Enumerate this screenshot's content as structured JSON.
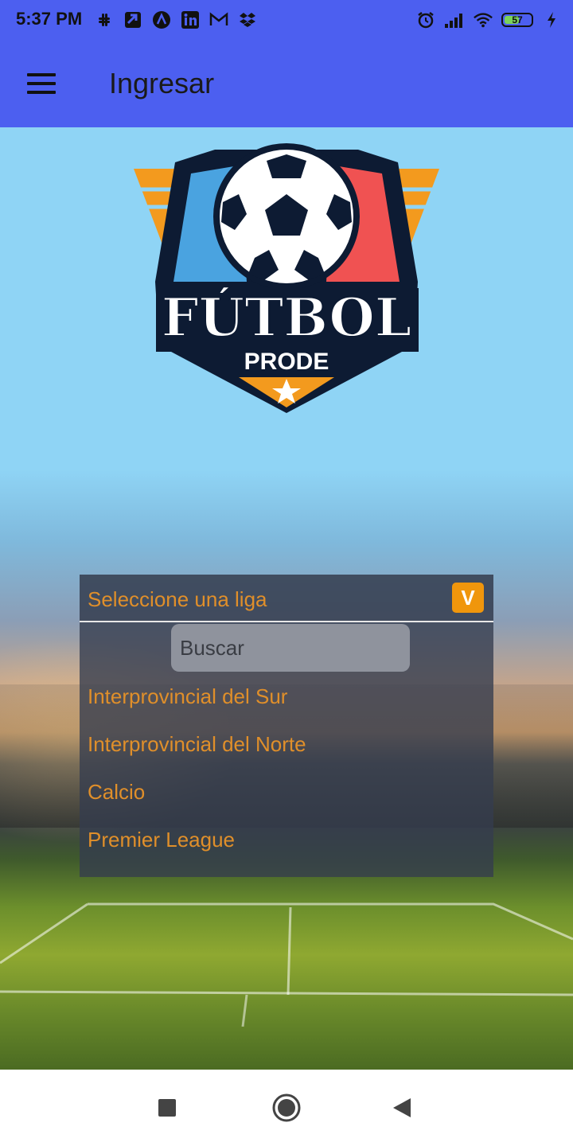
{
  "status_bar": {
    "time": "5:37 PM",
    "battery": "57",
    "battery_level": 0.57,
    "left_icons": [
      "slack-icon",
      "transfer-icon",
      "arc-icon",
      "linkedin-icon",
      "gmail-icon",
      "dropbox-icon"
    ],
    "right_icons": [
      "alarm-icon",
      "signal-icon",
      "wifi-icon",
      "battery-icon",
      "charging-icon"
    ]
  },
  "app_bar": {
    "title": "Ingresar",
    "menu_icon": "menu-icon",
    "background_color": "#4c5ff0"
  },
  "logo": {
    "word1": "FÚTBOL",
    "word2": "PRODE"
  },
  "dropdown": {
    "label": "Seleccione una liga",
    "toggle_text": "V",
    "search_placeholder": "Buscar",
    "options": [
      "Interprovincial del Sur",
      "Interprovincial del Norte",
      "Calcio",
      "Premier League"
    ],
    "accent_color": "#e08f2a",
    "toggle_color": "#f0960c"
  },
  "nav_bar": {
    "icons": [
      "recents-icon",
      "home-icon",
      "back-icon"
    ]
  }
}
